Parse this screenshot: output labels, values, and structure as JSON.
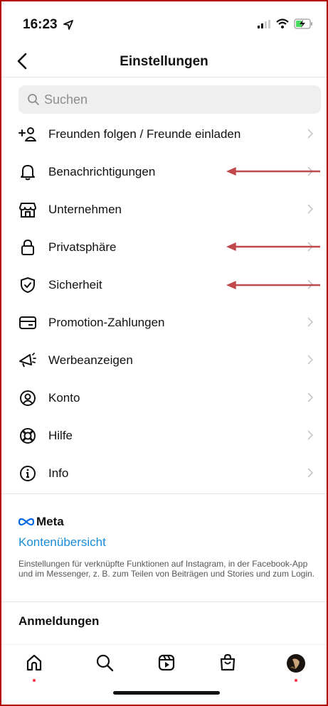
{
  "status_bar": {
    "time": "16:23"
  },
  "nav": {
    "title": "Einstellungen"
  },
  "search": {
    "placeholder": "Suchen"
  },
  "settings_items": [
    {
      "label": "Freunden folgen / Freunde einladen",
      "icon": "add-friend-icon"
    },
    {
      "label": "Benachrichtigungen",
      "icon": "bell-icon"
    },
    {
      "label": "Unternehmen",
      "icon": "store-icon"
    },
    {
      "label": "Privatsphäre",
      "icon": "lock-icon"
    },
    {
      "label": "Sicherheit",
      "icon": "shield-icon"
    },
    {
      "label": "Promotion-Zahlungen",
      "icon": "card-icon"
    },
    {
      "label": "Werbeanzeigen",
      "icon": "megaphone-icon"
    },
    {
      "label": "Konto",
      "icon": "account-icon"
    },
    {
      "label": "Hilfe",
      "icon": "lifebuoy-icon"
    },
    {
      "label": "Info",
      "icon": "info-icon"
    }
  ],
  "meta": {
    "logo_text": "Meta",
    "accounts_center": "Kontenübersicht",
    "description": "Einstellungen für verknüpfte Funktionen auf Instagram, in der Facebook-App und im Messenger, z. B. zum Teilen von Beiträgen und Stories und zum Login."
  },
  "logins": {
    "title": "Anmeldungen"
  },
  "tabbar": {
    "tabs": [
      "home-icon",
      "search-icon",
      "reels-icon",
      "shop-icon",
      "profile-avatar"
    ]
  },
  "colors": {
    "accent": "#1a8cd8",
    "annotation_arrow": "#c0474a",
    "notification_dot": "#ff3040"
  }
}
